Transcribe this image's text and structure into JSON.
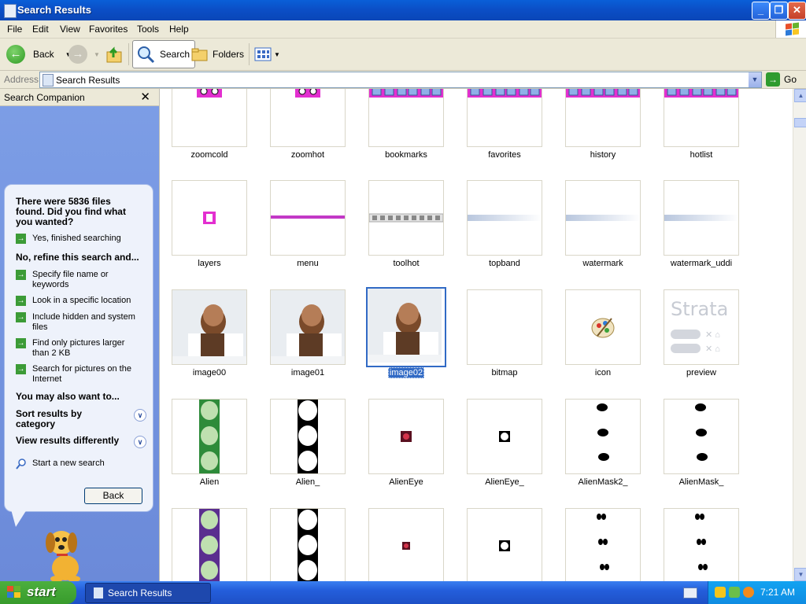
{
  "window": {
    "title": "Search Results",
    "controls": [
      "_",
      "❐",
      "✕"
    ]
  },
  "menu": [
    "File",
    "Edit",
    "View",
    "Favorites",
    "Tools",
    "Help"
  ],
  "toolbar": {
    "back_label": "Back",
    "search_label": "Search",
    "folders_label": "Folders"
  },
  "address": {
    "label": "Address",
    "value": "Search Results",
    "go_label": "Go"
  },
  "search_companion": {
    "title": "Search Companion",
    "close": "✕",
    "results_message": "There were 5836 files found. Did you find what you wanted?",
    "yes_link": "Yes, finished searching",
    "refine_heading": "No, refine this search and...",
    "refine_options": [
      "Specify file name or keywords",
      "Look in a specific location",
      "Include hidden and system files",
      "Find only pictures larger than 2 KB",
      "Search for pictures on the Internet"
    ],
    "also_heading": "You may also want to...",
    "sort_option": "Sort results by category",
    "view_option": "View results differently",
    "new_search": "Start a new search",
    "back_button": "Back"
  },
  "results": [
    {
      "name": "zoomcold",
      "kind": "zoom"
    },
    {
      "name": "zoomhot",
      "kind": "zoom"
    },
    {
      "name": "bookmarks",
      "kind": "strip"
    },
    {
      "name": "favorites",
      "kind": "strip"
    },
    {
      "name": "history",
      "kind": "strip"
    },
    {
      "name": "hotlist",
      "kind": "strip"
    },
    {
      "name": "layers",
      "kind": "layers"
    },
    {
      "name": "menu",
      "kind": "menu"
    },
    {
      "name": "toolhot",
      "kind": "toolhot"
    },
    {
      "name": "topband",
      "kind": "band"
    },
    {
      "name": "watermark",
      "kind": "band"
    },
    {
      "name": "watermark_uddi",
      "kind": "band"
    },
    {
      "name": "image00",
      "kind": "photo"
    },
    {
      "name": "image01",
      "kind": "photo"
    },
    {
      "name": "image02",
      "kind": "photo",
      "selected": true
    },
    {
      "name": "bitmap",
      "kind": "blank"
    },
    {
      "name": "icon",
      "kind": "icon"
    },
    {
      "name": "preview",
      "kind": "preview",
      "text": "Strata"
    },
    {
      "name": "Alien",
      "kind": "alien"
    },
    {
      "name": "Alien_",
      "kind": "alienmask"
    },
    {
      "name": "AlienEye",
      "kind": "eye"
    },
    {
      "name": "AlienEye_",
      "kind": "eyemask"
    },
    {
      "name": "AlienMask2_",
      "kind": "dots"
    },
    {
      "name": "AlienMask_",
      "kind": "dots"
    },
    {
      "name": "",
      "kind": "alien2"
    },
    {
      "name": "",
      "kind": "alienmask"
    },
    {
      "name": "",
      "kind": "eyesmall"
    },
    {
      "name": "",
      "kind": "eyemask"
    },
    {
      "name": "",
      "kind": "dots2"
    },
    {
      "name": "",
      "kind": "dots2"
    }
  ],
  "taskbar": {
    "start_label": "start",
    "task_label": "Search Results",
    "clock": "7:21 AM"
  },
  "colors": {
    "selection": "#316ac5",
    "titlebar": "#0a5fd8",
    "pane": "#7d9ee6"
  }
}
